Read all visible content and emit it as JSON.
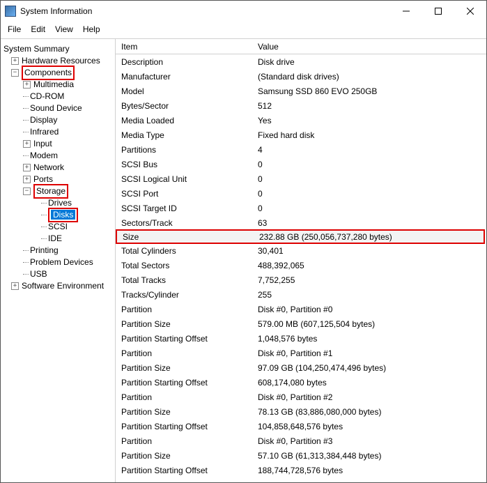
{
  "window": {
    "title": "System Information"
  },
  "menubar": [
    "File",
    "Edit",
    "View",
    "Help"
  ],
  "tree": {
    "root": "System Summary",
    "nodes": [
      {
        "label": "Hardware Resources",
        "indent": 1,
        "exp": "+",
        "hl": false
      },
      {
        "label": "Components",
        "indent": 1,
        "exp": "−",
        "hl": true
      },
      {
        "label": "Multimedia",
        "indent": 2,
        "exp": "+",
        "hl": false
      },
      {
        "label": "CD-ROM",
        "indent": 2,
        "exp": "",
        "hl": false,
        "dot": true
      },
      {
        "label": "Sound Device",
        "indent": 2,
        "exp": "",
        "hl": false,
        "dot": true
      },
      {
        "label": "Display",
        "indent": 2,
        "exp": "",
        "hl": false,
        "dot": true
      },
      {
        "label": "Infrared",
        "indent": 2,
        "exp": "",
        "hl": false,
        "dot": true
      },
      {
        "label": "Input",
        "indent": 2,
        "exp": "+",
        "hl": false
      },
      {
        "label": "Modem",
        "indent": 2,
        "exp": "",
        "hl": false,
        "dot": true
      },
      {
        "label": "Network",
        "indent": 2,
        "exp": "+",
        "hl": false
      },
      {
        "label": "Ports",
        "indent": 2,
        "exp": "+",
        "hl": false
      },
      {
        "label": "Storage",
        "indent": 2,
        "exp": "−",
        "hl": true
      },
      {
        "label": "Drives",
        "indent": 3,
        "exp": "",
        "hl": false,
        "dot": true
      },
      {
        "label": "Disks",
        "indent": 3,
        "exp": "",
        "hl": true,
        "dot": true,
        "sel": true
      },
      {
        "label": "SCSI",
        "indent": 3,
        "exp": "",
        "hl": false,
        "dot": true
      },
      {
        "label": "IDE",
        "indent": 3,
        "exp": "",
        "hl": false,
        "dot": true
      },
      {
        "label": "Printing",
        "indent": 2,
        "exp": "",
        "hl": false,
        "dot": true
      },
      {
        "label": "Problem Devices",
        "indent": 2,
        "exp": "",
        "hl": false,
        "dot": true
      },
      {
        "label": "USB",
        "indent": 2,
        "exp": "",
        "hl": false,
        "dot": true
      },
      {
        "label": "Software Environment",
        "indent": 1,
        "exp": "+",
        "hl": false
      }
    ]
  },
  "columns": {
    "item": "Item",
    "value": "Value"
  },
  "rows": [
    {
      "item": "Description",
      "value": "Disk drive"
    },
    {
      "item": "Manufacturer",
      "value": "(Standard disk drives)"
    },
    {
      "item": "Model",
      "value": "Samsung SSD 860 EVO 250GB"
    },
    {
      "item": "Bytes/Sector",
      "value": "512"
    },
    {
      "item": "Media Loaded",
      "value": "Yes"
    },
    {
      "item": "Media Type",
      "value": "Fixed hard disk"
    },
    {
      "item": "Partitions",
      "value": "4"
    },
    {
      "item": "SCSI Bus",
      "value": "0"
    },
    {
      "item": "SCSI Logical Unit",
      "value": "0"
    },
    {
      "item": "SCSI Port",
      "value": "0"
    },
    {
      "item": "SCSI Target ID",
      "value": "0"
    },
    {
      "item": "Sectors/Track",
      "value": "63"
    },
    {
      "item": "Size",
      "value": "232.88 GB (250,056,737,280 bytes)",
      "hl": true
    },
    {
      "item": "Total Cylinders",
      "value": "30,401"
    },
    {
      "item": "Total Sectors",
      "value": "488,392,065"
    },
    {
      "item": "Total Tracks",
      "value": "7,752,255"
    },
    {
      "item": "Tracks/Cylinder",
      "value": "255"
    },
    {
      "item": "Partition",
      "value": "Disk #0, Partition #0"
    },
    {
      "item": "Partition Size",
      "value": "579.00 MB (607,125,504 bytes)"
    },
    {
      "item": "Partition Starting Offset",
      "value": "1,048,576 bytes"
    },
    {
      "item": "Partition",
      "value": "Disk #0, Partition #1"
    },
    {
      "item": "Partition Size",
      "value": "97.09 GB (104,250,474,496 bytes)"
    },
    {
      "item": "Partition Starting Offset",
      "value": "608,174,080 bytes"
    },
    {
      "item": "Partition",
      "value": "Disk #0, Partition #2"
    },
    {
      "item": "Partition Size",
      "value": "78.13 GB (83,886,080,000 bytes)"
    },
    {
      "item": "Partition Starting Offset",
      "value": "104,858,648,576 bytes"
    },
    {
      "item": "Partition",
      "value": "Disk #0, Partition #3"
    },
    {
      "item": "Partition Size",
      "value": "57.10 GB (61,313,384,448 bytes)"
    },
    {
      "item": "Partition Starting Offset",
      "value": "188,744,728,576 bytes"
    }
  ]
}
